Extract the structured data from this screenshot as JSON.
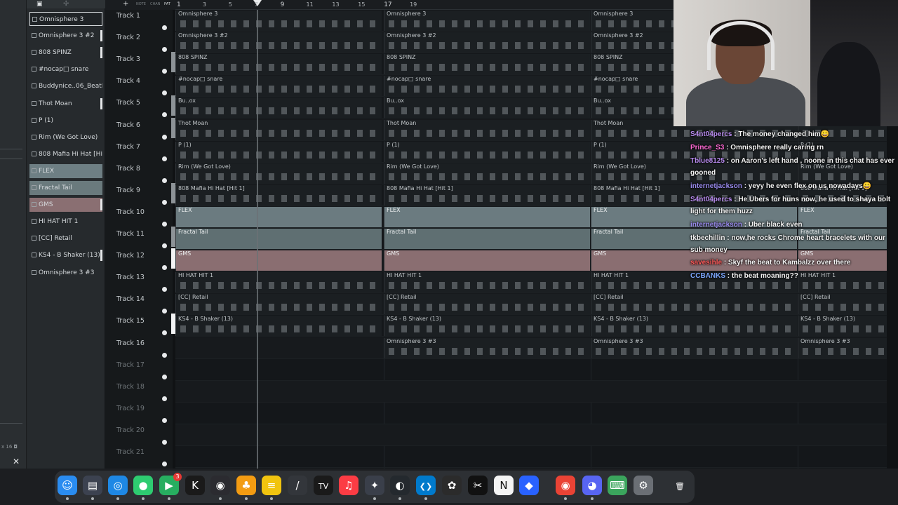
{
  "browser_strip": {
    "zoom_text": "16"
  },
  "channels": [
    {
      "label": "Omnisphere 3",
      "style": "sel",
      "marker": false
    },
    {
      "label": "Omnisphere 3 #2",
      "style": "",
      "marker": true
    },
    {
      "label": "808 SPINZ",
      "style": "",
      "marker": true
    },
    {
      "label": "#nocap□ snare",
      "style": "",
      "marker": false
    },
    {
      "label": "Buddynice..06_BeatBox",
      "style": "",
      "marker": false
    },
    {
      "label": "Thot Moan",
      "style": "",
      "marker": true
    },
    {
      "label": "P (1)",
      "style": "",
      "marker": false
    },
    {
      "label": "Rim (We Got Love)",
      "style": "",
      "marker": false
    },
    {
      "label": "808 Mafia Hi Hat [Hit 1]",
      "style": "",
      "marker": false
    },
    {
      "label": "FLEX",
      "style": "flex",
      "marker": false
    },
    {
      "label": "Fractal Tail",
      "style": "fractal",
      "marker": false
    },
    {
      "label": "GMS",
      "style": "gms",
      "marker": true
    },
    {
      "label": "HI HAT HIT 1",
      "style": "",
      "marker": false
    },
    {
      "label": "[CC] Retail",
      "style": "",
      "marker": false
    },
    {
      "label": "KS4 - B Shaker (13)",
      "style": "",
      "marker": true
    },
    {
      "label": "Omnisphere 3 #3",
      "style": "",
      "marker": false
    }
  ],
  "toolbar": {
    "a": "NOTE",
    "b": "CHAN",
    "c": "PAT"
  },
  "timeline": [
    "1",
    "3",
    "5",
    "7",
    "9",
    "11",
    "13",
    "15",
    "17",
    "19"
  ],
  "tracks": [
    "Track 1",
    "Track 2",
    "Track 3",
    "Track 4",
    "Track 5",
    "Track 6",
    "Track 7",
    "Track 8",
    "Track 9",
    "Track 10",
    "Track 11",
    "Track 12",
    "Track 13",
    "Track 14",
    "Track 15",
    "Track 16",
    "Track 17",
    "Track 18",
    "Track 19",
    "Track 20",
    "Track 21"
  ],
  "clips": [
    {
      "name": "Omnisphere 3",
      "style": ""
    },
    {
      "name": "Omnisphere 3 #2",
      "style": ""
    },
    {
      "name": "808 SPINZ",
      "style": ""
    },
    {
      "name": "#nocap□ snare",
      "style": ""
    },
    {
      "name": "Bu..ox",
      "style": ""
    },
    {
      "name": "Thot Moan",
      "style": ""
    },
    {
      "name": "P (1)",
      "style": ""
    },
    {
      "name": "Rim (We Got Love)",
      "style": ""
    },
    {
      "name": "808 Mafia Hi Hat [Hit 1]",
      "style": ""
    },
    {
      "name": "FLEX",
      "style": "c-flex"
    },
    {
      "name": "Fractal Tail",
      "style": "c-fractal"
    },
    {
      "name": "GMS",
      "style": "c-gms"
    },
    {
      "name": "HI HAT HIT 1",
      "style": ""
    },
    {
      "name": "[CC] Retail",
      "style": ""
    },
    {
      "name": "KS4 - B Shaker (13)",
      "style": ""
    },
    {
      "name": "Omnisphere 3 #3",
      "style": ""
    }
  ],
  "chat": [
    {
      "user": "S4nt04percs",
      "color": "#b98cf0",
      "text": " : The money changed him😀"
    },
    {
      "user": "Prince_S3",
      "color": "#ff6ad5",
      "text": " : Omnisphere really caring rn"
    },
    {
      "user": "Tblue8125",
      "color": "#b98cf0",
      "text": " : on Aaron's left hand , noone in this chat has ever gooned"
    },
    {
      "user": "internetjackson",
      "color": "#9b8cf0",
      "text": " : yeyy he even flex on us nowadays😀"
    },
    {
      "user": "S4nt04percs",
      "color": "#b98cf0",
      "text": " : He Ubers for huns now, he used to shaya bolt light for them huzz"
    },
    {
      "user": "internetjackson",
      "color": "#9b8cf0",
      "text": " : Uber black even"
    },
    {
      "user": "tkbechillin",
      "color": "#f4f4f4",
      "text": " : now,he rocks Chrome heart bracelets with our sub money"
    },
    {
      "user": "savesihle",
      "color": "#ff5a5a",
      "text": " : Skyf the beat to Kambalzz over there"
    },
    {
      "user": "CCBANKS",
      "color": "#7da8ff",
      "text": " : the beat moaning??"
    }
  ],
  "dock": [
    {
      "name": "finder-icon",
      "glyph": "☺",
      "bg": "#2a8cf0"
    },
    {
      "name": "files-icon",
      "glyph": "▤",
      "bg": "#3c4250"
    },
    {
      "name": "safari-icon",
      "glyph": "◎",
      "bg": "#1e88e5"
    },
    {
      "name": "messages-icon",
      "glyph": "●",
      "bg": "#2ecc71"
    },
    {
      "name": "facetime-icon",
      "glyph": "▶",
      "bg": "#27ae60",
      "badge": "3"
    },
    {
      "name": "kick-icon",
      "glyph": "K",
      "bg": "#1a1a1a"
    },
    {
      "name": "obs-icon",
      "glyph": "◉",
      "bg": "#2b2b30"
    },
    {
      "name": "fl-studio-icon",
      "glyph": "♣",
      "bg": "#f39c12"
    },
    {
      "name": "notes-icon",
      "glyph": "≡",
      "bg": "#f1c40f"
    },
    {
      "name": "pen-icon",
      "glyph": "/",
      "bg": "#33363b"
    },
    {
      "name": "tradingview-icon",
      "glyph": "TV",
      "bg": "#1a1a1a"
    },
    {
      "name": "music-icon",
      "glyph": "♫",
      "bg": "#fc3c44"
    },
    {
      "name": "davinci-icon",
      "glyph": "✦",
      "bg": "#3a3f4a"
    },
    {
      "name": "github-icon",
      "glyph": "◐",
      "bg": "#24292e"
    },
    {
      "name": "vscode-icon",
      "glyph": "❮❯",
      "bg": "#007acc"
    },
    {
      "name": "chatgpt-icon",
      "glyph": "✿",
      "bg": "#2b2b2b"
    },
    {
      "name": "capcut-icon",
      "glyph": "✂",
      "bg": "#111111"
    },
    {
      "name": "notion-icon",
      "glyph": "N",
      "bg": "#f4f4f4"
    },
    {
      "name": "cube-icon",
      "glyph": "◆",
      "bg": "#2962ff"
    },
    {
      "name": "chrome-icon",
      "glyph": "◉",
      "bg": "#ea4335"
    },
    {
      "name": "discord-icon",
      "glyph": "◕",
      "bg": "#5865f2"
    },
    {
      "name": "keyboard-app-icon",
      "glyph": "⌨",
      "bg": "#3ba55d"
    },
    {
      "name": "settings-icon",
      "glyph": "⚙",
      "bg": "#6b6f75"
    },
    {
      "name": "trash-icon",
      "glyph": "🗑",
      "bg": "transparent"
    }
  ]
}
